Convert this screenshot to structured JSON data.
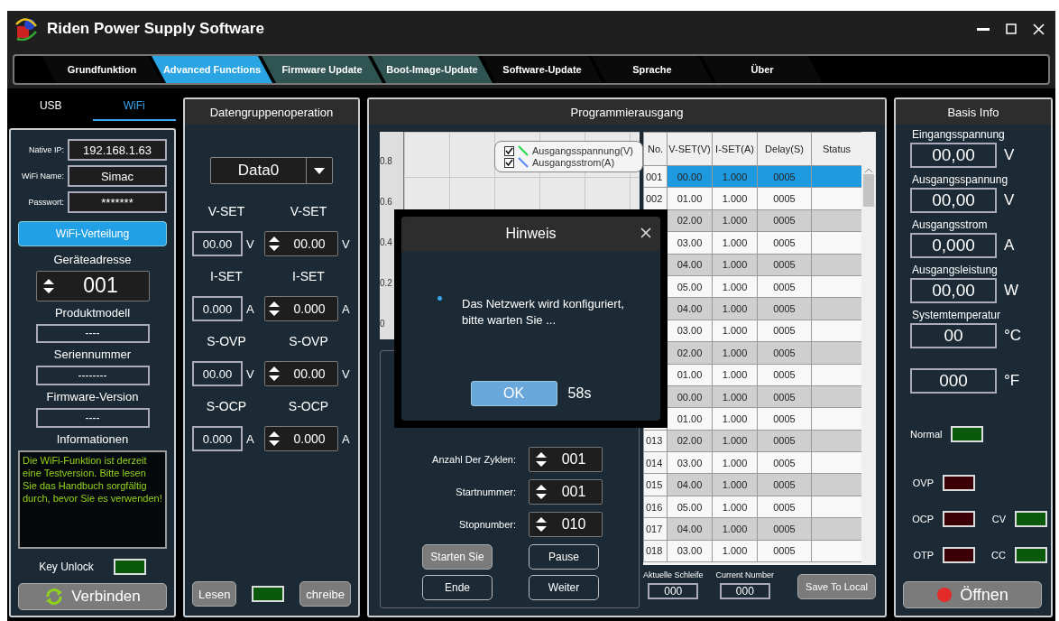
{
  "window": {
    "title": "Riden Power Supply Software"
  },
  "tabs": [
    {
      "label": "Grundfunktion",
      "selected": false,
      "highlighted": false
    },
    {
      "label": "Advanced Functions",
      "selected": true,
      "highlighted": false
    },
    {
      "label": "Firmware Update",
      "selected": false,
      "highlighted": true
    },
    {
      "label": "Boot-Image-Update",
      "selected": false,
      "highlighted": true
    },
    {
      "label": "Software-Update",
      "selected": false,
      "highlighted": false
    },
    {
      "label": "Sprache",
      "selected": false,
      "highlighted": false
    },
    {
      "label": "Über",
      "selected": false,
      "highlighted": false
    }
  ],
  "connection_tabs": [
    {
      "label": "USB",
      "selected": false
    },
    {
      "label": "WiFi",
      "selected": true
    }
  ],
  "wifi_panel": {
    "fields": [
      {
        "label": "Native IP:",
        "value": "192.168.1.63"
      },
      {
        "label": "WiFi Name:",
        "value": "Simac"
      },
      {
        "label": "Passwort:",
        "value": "*******"
      }
    ],
    "distribute_button": "WiFi-Verteilung",
    "address": {
      "label": "Geräteadresse",
      "value": "001"
    },
    "info_fields": [
      {
        "label": "Produktmodell",
        "value": "----"
      },
      {
        "label": "Seriennummer",
        "value": "--------"
      },
      {
        "label": "Firmware-Version",
        "value": "----"
      }
    ],
    "info": {
      "label": "Informationen",
      "text": "Die WiFi-Funktion ist derzeit eine Testversion. Bitte lesen Sie das Handbuch sorgfältig durch, bevor Sie es verwenden!"
    },
    "key_unlock": {
      "label": "Key Unlock",
      "on": true
    },
    "connect_button": "Verbinden"
  },
  "data_group": {
    "title": "Datengruppenoperation",
    "selector": "Data0",
    "params": [
      {
        "label": "V-SET",
        "value": "00.00",
        "unit": "V",
        "set_label": "V-SET",
        "set_value": "00.00",
        "set_unit": "V"
      },
      {
        "label": "I-SET",
        "value": "0.000",
        "unit": "A",
        "set_label": "I-SET",
        "set_value": "0.000",
        "set_unit": "A"
      },
      {
        "label": "S-OVP",
        "value": "00.00",
        "unit": "V",
        "set_label": "S-OVP",
        "set_value": "00.00",
        "set_unit": "V"
      },
      {
        "label": "S-OCP",
        "value": "0.000",
        "unit": "A",
        "set_label": "S-OCP",
        "set_value": "0.000",
        "set_unit": "A"
      }
    ],
    "read_button": "Lesen",
    "status": {
      "on": true
    },
    "write_button": "chreibe"
  },
  "program": {
    "title": "Programmierausgang",
    "chart": {
      "y_ticks": [
        "0.8",
        "0.6",
        "0.4",
        "0.2",
        "0"
      ],
      "legend": [
        {
          "label": "Ausgangsspannung(V)",
          "checked": true,
          "color": "#22dd44"
        },
        {
          "label": "Ausgangsstrom(A)",
          "checked": true,
          "color": "#5588ff"
        }
      ]
    },
    "cycle_fields": [
      {
        "label": "Anzahl Der Zyklen:",
        "value": "001"
      },
      {
        "label": "Startnummer:",
        "value": "001"
      },
      {
        "label": "Stopnumber:",
        "value": "010"
      }
    ],
    "buttons": [
      {
        "label": "Starten Sie",
        "kind": "filled"
      },
      {
        "label": "Pause",
        "kind": "outline"
      },
      {
        "label": "Ende",
        "kind": "outline"
      },
      {
        "label": "Weiter",
        "kind": "outline"
      }
    ],
    "table": {
      "columns": [
        "No.",
        "V-SET(V)",
        "I-SET(A)",
        "Delay(S)",
        "Status"
      ],
      "rows": [
        {
          "no": "001",
          "vset": "00.00",
          "iset": "1.000",
          "delay": "0005",
          "selected": true
        },
        {
          "no": "002",
          "vset": "01.00",
          "iset": "1.000",
          "delay": "0005",
          "selected": false
        },
        {
          "vset": "02.00",
          "iset": "1.000",
          "delay": "0005",
          "selected": false
        },
        {
          "vset": "03.00",
          "iset": "1.000",
          "delay": "0005",
          "selected": false
        },
        {
          "vset": "04.00",
          "iset": "1.000",
          "delay": "0005",
          "selected": false
        },
        {
          "vset": "05.00",
          "iset": "1.000",
          "delay": "0005",
          "selected": false
        },
        {
          "vset": "04.00",
          "iset": "1.000",
          "delay": "0005",
          "selected": false
        },
        {
          "vset": "03.00",
          "iset": "1.000",
          "delay": "0005",
          "selected": false
        },
        {
          "vset": "02.00",
          "iset": "1.000",
          "delay": "0005",
          "selected": false
        },
        {
          "vset": "01.00",
          "iset": "1.000",
          "delay": "0005",
          "selected": false
        },
        {
          "vset": "00.00",
          "iset": "1.000",
          "delay": "0005",
          "selected": false
        },
        {
          "vset": "01.00",
          "iset": "1.000",
          "delay": "0005",
          "selected": false
        },
        {
          "no": "013",
          "vset": "02.00",
          "iset": "1.000",
          "delay": "0005",
          "selected": false
        },
        {
          "no": "014",
          "vset": "03.00",
          "iset": "1.000",
          "delay": "0005",
          "selected": false
        },
        {
          "no": "015",
          "vset": "04.00",
          "iset": "1.000",
          "delay": "0005",
          "selected": false
        },
        {
          "no": "016",
          "vset": "05.00",
          "iset": "1.000",
          "delay": "0005",
          "selected": false
        },
        {
          "no": "017",
          "vset": "04.00",
          "iset": "1.000",
          "delay": "0005",
          "selected": false
        },
        {
          "no": "018",
          "vset": "03.00",
          "iset": "1.000",
          "delay": "0005",
          "selected": false
        }
      ]
    },
    "counters": [
      {
        "label": "Aktuelle Schleife",
        "value": "000"
      },
      {
        "label": "Current Number",
        "value": "000"
      }
    ],
    "save_button": "Save To Local"
  },
  "basis": {
    "title": "Basis Info",
    "readings": [
      {
        "label": "Eingangsspannung",
        "value": "00,00",
        "unit": "V"
      },
      {
        "label": "Ausgangsspannung",
        "value": "00,00",
        "unit": "V"
      },
      {
        "label": "Ausgangsstrom",
        "value": "0,000",
        "unit": "A"
      },
      {
        "label": "Ausgangsleistung",
        "value": "00,00",
        "unit": "W"
      },
      {
        "label": "Systemtemperatur",
        "value": "00",
        "unit": "°C"
      },
      {
        "value": "000",
        "unit": "°F"
      }
    ],
    "indicators": [
      [
        {
          "label": "Normal",
          "on": true
        }
      ],
      [
        {
          "label": "OVP",
          "on": false
        }
      ],
      [
        {
          "label": "OCP",
          "on": false
        },
        {
          "label": "CV",
          "on": true
        }
      ],
      [
        {
          "label": "OTP",
          "on": false
        },
        {
          "label": "CC",
          "on": true
        }
      ]
    ],
    "open_button": "Öffnen"
  },
  "dialog": {
    "title": "Hinweis",
    "message": "Das Netzwerk wird konfiguriert, bitte warten Sie ...",
    "ok_button": "OK",
    "countdown": "58s"
  }
}
